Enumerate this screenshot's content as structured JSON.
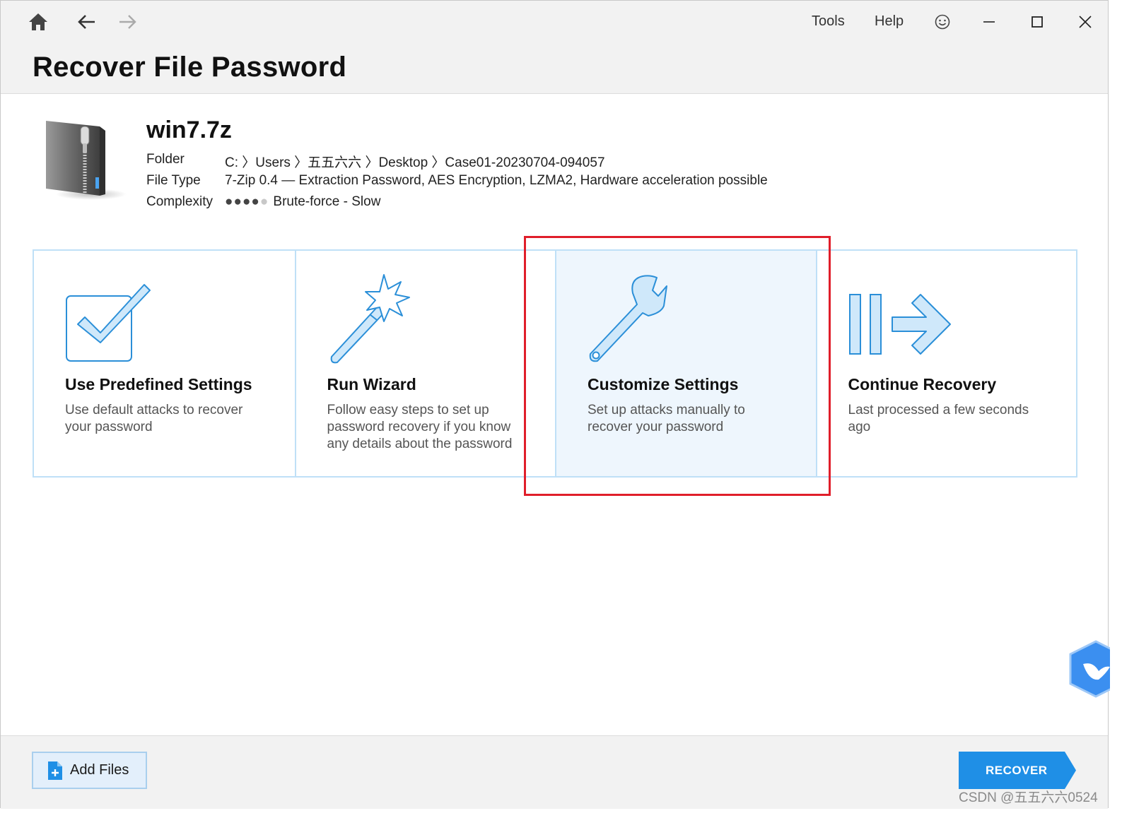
{
  "menu": {
    "tools": "Tools",
    "help": "Help"
  },
  "page_title": "Recover File Password",
  "file": {
    "name": "win7.7z",
    "folder_label": "Folder",
    "folder_value": "C: 〉Users 〉五五六六 〉Desktop 〉Case01-20230704-094057",
    "filetype_label": "File Type",
    "filetype_value": "7-Zip 0.4 — Extraction Password, AES Encryption, LZMA2, Hardware acceleration possible",
    "complexity_label": "Complexity",
    "complexity_dots_filled": "●●●●",
    "complexity_dots_empty": "●",
    "complexity_value": "Brute-force - Slow"
  },
  "cards": [
    {
      "title": "Use Predefined Settings",
      "desc": "Use default attacks to recover your password",
      "icon": "checkbox-icon"
    },
    {
      "title": "Run Wizard",
      "desc": "Follow easy steps to set up password recovery if you know any details about the password",
      "icon": "magic-wand-icon"
    },
    {
      "title": "Customize Settings",
      "desc": "Set up attacks manually to recover your password",
      "icon": "wrench-icon"
    },
    {
      "title": "Continue Recovery",
      "desc": "Last processed a few seconds ago",
      "icon": "continue-arrow-icon"
    }
  ],
  "footer": {
    "add_files": "Add Files",
    "recover": "RECOVER"
  },
  "watermark": "CSDN @五五六六0524",
  "colors": {
    "accent": "#1f8fe6",
    "card_border": "#bfe0f7",
    "highlight": "#e01e2a",
    "icon_stroke": "#2b8fd8",
    "icon_fill": "#cfe8fa"
  }
}
